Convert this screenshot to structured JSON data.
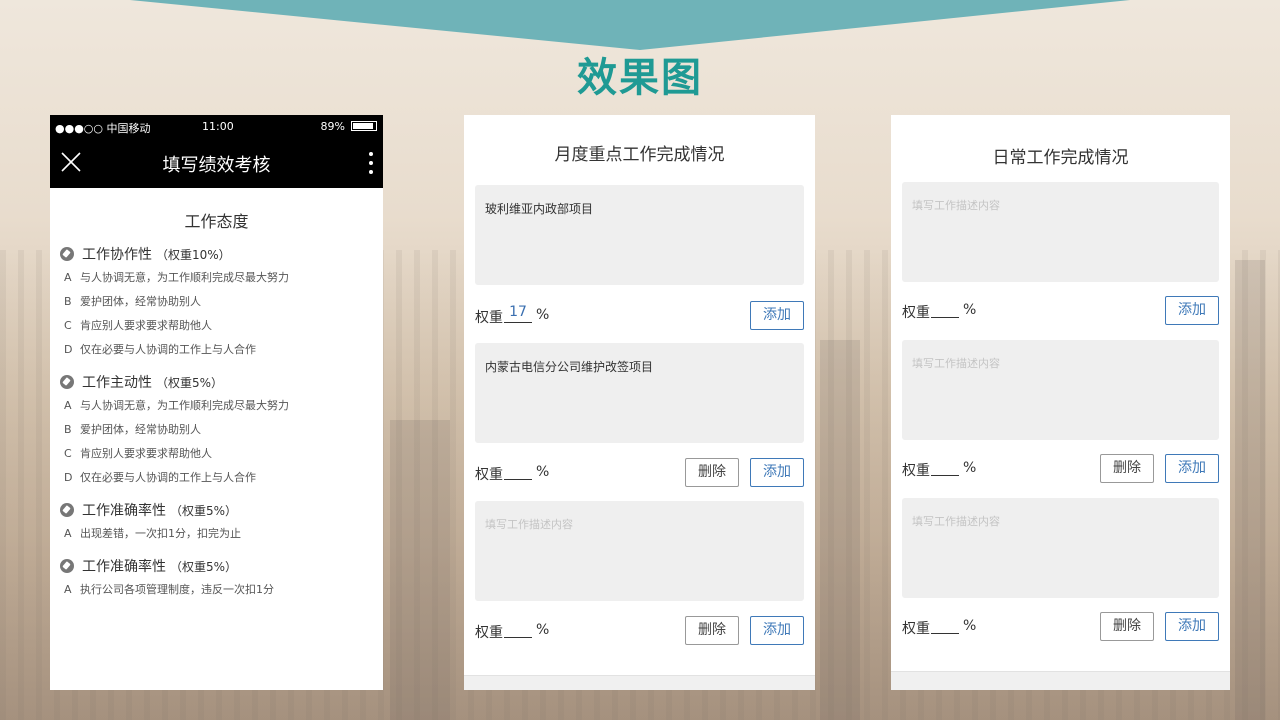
{
  "slide": {
    "title": "效果图",
    "accent_color": "#1f9a94",
    "banner_color": "#6fb3b8"
  },
  "phone": {
    "status": {
      "carrier": "●●●○○ 中国移动",
      "time": "11:00",
      "battery": "89%"
    },
    "nav": {
      "title": "填写绩效考核",
      "close_icon": "close-icon",
      "more_icon": "more-vertical-icon"
    },
    "section_title": "工作态度",
    "questions": [
      {
        "title": "工作协作性",
        "weight": "（权重10%）",
        "options": [
          {
            "letter": "A",
            "text": "与人协调无意，为工作顺利完成尽最大努力"
          },
          {
            "letter": "B",
            "text": "爱护团体，经常协助别人"
          },
          {
            "letter": "C",
            "text": "肯应别人要求要求帮助他人"
          },
          {
            "letter": "D",
            "text": "仅在必要与人协调的工作上与人合作"
          }
        ]
      },
      {
        "title": "工作主动性",
        "weight": "（权重5%）",
        "options": [
          {
            "letter": "A",
            "text": "与人协调无意，为工作顺利完成尽最大努力"
          },
          {
            "letter": "B",
            "text": "爱护团体，经常协助别人"
          },
          {
            "letter": "C",
            "text": "肯应别人要求要求帮助他人"
          },
          {
            "letter": "D",
            "text": "仅在必要与人协调的工作上与人合作"
          }
        ]
      },
      {
        "title": "工作准确率性",
        "weight": "（权重5%）",
        "options": [
          {
            "letter": "A",
            "text": "出现差错，一次扣1分，扣完为止"
          }
        ]
      },
      {
        "title": "工作准确率性",
        "weight": "（权重5%）",
        "options": [
          {
            "letter": "A",
            "text": "执行公司各项管理制度，违反一次扣1分"
          }
        ]
      }
    ]
  },
  "monthly": {
    "title": "月度重点工作完成情况",
    "weight_label": "权重",
    "percent": "%",
    "add_label": "添加",
    "delete_label": "删除",
    "items": [
      {
        "desc": "玻利维亚内政部项目",
        "weight": "17"
      },
      {
        "desc": "内蒙古电信分公司维护改签项目",
        "weight": ""
      },
      {
        "desc": "",
        "placeholder": "填写工作描述内容",
        "weight": ""
      }
    ]
  },
  "daily": {
    "title": "日常工作完成情况",
    "weight_label": "权重",
    "percent": "%",
    "add_label": "添加",
    "delete_label": "删除",
    "items": [
      {
        "desc": "",
        "placeholder": "填写工作描述内容",
        "weight": ""
      },
      {
        "desc": "",
        "placeholder": "填写工作描述内容",
        "weight": ""
      },
      {
        "desc": "",
        "placeholder": "填写工作描述内容",
        "weight": ""
      }
    ]
  }
}
